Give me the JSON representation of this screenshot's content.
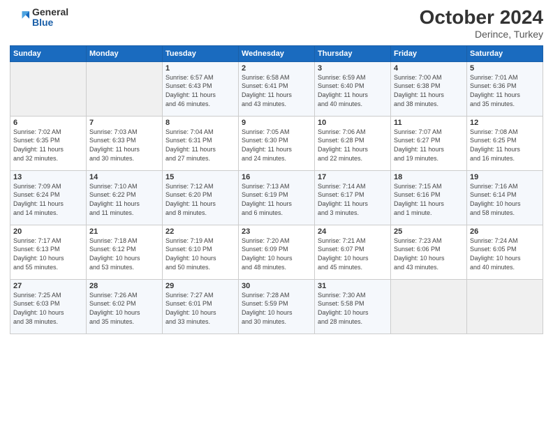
{
  "header": {
    "logo_general": "General",
    "logo_blue": "Blue",
    "month": "October 2024",
    "location": "Derince, Turkey"
  },
  "days_of_week": [
    "Sunday",
    "Monday",
    "Tuesday",
    "Wednesday",
    "Thursday",
    "Friday",
    "Saturday"
  ],
  "weeks": [
    [
      {
        "day": "",
        "detail": ""
      },
      {
        "day": "",
        "detail": ""
      },
      {
        "day": "1",
        "detail": "Sunrise: 6:57 AM\nSunset: 6:43 PM\nDaylight: 11 hours\nand 46 minutes."
      },
      {
        "day": "2",
        "detail": "Sunrise: 6:58 AM\nSunset: 6:41 PM\nDaylight: 11 hours\nand 43 minutes."
      },
      {
        "day": "3",
        "detail": "Sunrise: 6:59 AM\nSunset: 6:40 PM\nDaylight: 11 hours\nand 40 minutes."
      },
      {
        "day": "4",
        "detail": "Sunrise: 7:00 AM\nSunset: 6:38 PM\nDaylight: 11 hours\nand 38 minutes."
      },
      {
        "day": "5",
        "detail": "Sunrise: 7:01 AM\nSunset: 6:36 PM\nDaylight: 11 hours\nand 35 minutes."
      }
    ],
    [
      {
        "day": "6",
        "detail": "Sunrise: 7:02 AM\nSunset: 6:35 PM\nDaylight: 11 hours\nand 32 minutes."
      },
      {
        "day": "7",
        "detail": "Sunrise: 7:03 AM\nSunset: 6:33 PM\nDaylight: 11 hours\nand 30 minutes."
      },
      {
        "day": "8",
        "detail": "Sunrise: 7:04 AM\nSunset: 6:31 PM\nDaylight: 11 hours\nand 27 minutes."
      },
      {
        "day": "9",
        "detail": "Sunrise: 7:05 AM\nSunset: 6:30 PM\nDaylight: 11 hours\nand 24 minutes."
      },
      {
        "day": "10",
        "detail": "Sunrise: 7:06 AM\nSunset: 6:28 PM\nDaylight: 11 hours\nand 22 minutes."
      },
      {
        "day": "11",
        "detail": "Sunrise: 7:07 AM\nSunset: 6:27 PM\nDaylight: 11 hours\nand 19 minutes."
      },
      {
        "day": "12",
        "detail": "Sunrise: 7:08 AM\nSunset: 6:25 PM\nDaylight: 11 hours\nand 16 minutes."
      }
    ],
    [
      {
        "day": "13",
        "detail": "Sunrise: 7:09 AM\nSunset: 6:24 PM\nDaylight: 11 hours\nand 14 minutes."
      },
      {
        "day": "14",
        "detail": "Sunrise: 7:10 AM\nSunset: 6:22 PM\nDaylight: 11 hours\nand 11 minutes."
      },
      {
        "day": "15",
        "detail": "Sunrise: 7:12 AM\nSunset: 6:20 PM\nDaylight: 11 hours\nand 8 minutes."
      },
      {
        "day": "16",
        "detail": "Sunrise: 7:13 AM\nSunset: 6:19 PM\nDaylight: 11 hours\nand 6 minutes."
      },
      {
        "day": "17",
        "detail": "Sunrise: 7:14 AM\nSunset: 6:17 PM\nDaylight: 11 hours\nand 3 minutes."
      },
      {
        "day": "18",
        "detail": "Sunrise: 7:15 AM\nSunset: 6:16 PM\nDaylight: 11 hours\nand 1 minute."
      },
      {
        "day": "19",
        "detail": "Sunrise: 7:16 AM\nSunset: 6:14 PM\nDaylight: 10 hours\nand 58 minutes."
      }
    ],
    [
      {
        "day": "20",
        "detail": "Sunrise: 7:17 AM\nSunset: 6:13 PM\nDaylight: 10 hours\nand 55 minutes."
      },
      {
        "day": "21",
        "detail": "Sunrise: 7:18 AM\nSunset: 6:12 PM\nDaylight: 10 hours\nand 53 minutes."
      },
      {
        "day": "22",
        "detail": "Sunrise: 7:19 AM\nSunset: 6:10 PM\nDaylight: 10 hours\nand 50 minutes."
      },
      {
        "day": "23",
        "detail": "Sunrise: 7:20 AM\nSunset: 6:09 PM\nDaylight: 10 hours\nand 48 minutes."
      },
      {
        "day": "24",
        "detail": "Sunrise: 7:21 AM\nSunset: 6:07 PM\nDaylight: 10 hours\nand 45 minutes."
      },
      {
        "day": "25",
        "detail": "Sunrise: 7:23 AM\nSunset: 6:06 PM\nDaylight: 10 hours\nand 43 minutes."
      },
      {
        "day": "26",
        "detail": "Sunrise: 7:24 AM\nSunset: 6:05 PM\nDaylight: 10 hours\nand 40 minutes."
      }
    ],
    [
      {
        "day": "27",
        "detail": "Sunrise: 7:25 AM\nSunset: 6:03 PM\nDaylight: 10 hours\nand 38 minutes."
      },
      {
        "day": "28",
        "detail": "Sunrise: 7:26 AM\nSunset: 6:02 PM\nDaylight: 10 hours\nand 35 minutes."
      },
      {
        "day": "29",
        "detail": "Sunrise: 7:27 AM\nSunset: 6:01 PM\nDaylight: 10 hours\nand 33 minutes."
      },
      {
        "day": "30",
        "detail": "Sunrise: 7:28 AM\nSunset: 5:59 PM\nDaylight: 10 hours\nand 30 minutes."
      },
      {
        "day": "31",
        "detail": "Sunrise: 7:30 AM\nSunset: 5:58 PM\nDaylight: 10 hours\nand 28 minutes."
      },
      {
        "day": "",
        "detail": ""
      },
      {
        "day": "",
        "detail": ""
      }
    ]
  ]
}
